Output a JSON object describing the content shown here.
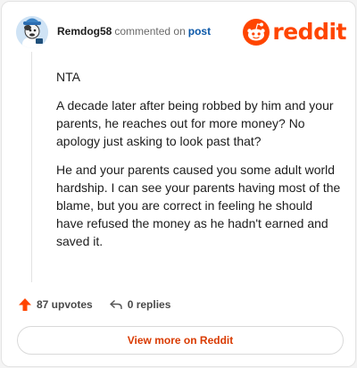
{
  "comment": {
    "author": "Remdog58",
    "action_text": "commented on",
    "target_link": "post",
    "paragraphs": [
      "NTA",
      "A decade later after being robbed by him and your parents, he reaches out for more money? No apology just asking to look past that?",
      "He and your parents caused you some adult world hardship. I can see your parents having most of the blame, but you are correct in feeling he should have refused the money as he hadn't earned and saved it."
    ],
    "upvotes_label": "87 upvotes",
    "replies_label": "0 replies"
  },
  "brand": {
    "wordmark": "reddit",
    "color": "#ff4500"
  },
  "footer": {
    "view_more_label": "View more on Reddit"
  },
  "icons": {
    "upvote": "arrow-up-icon",
    "reply": "reply-arrow-icon",
    "logo": "reddit-snoo-icon",
    "avatar": "user-avatar"
  }
}
